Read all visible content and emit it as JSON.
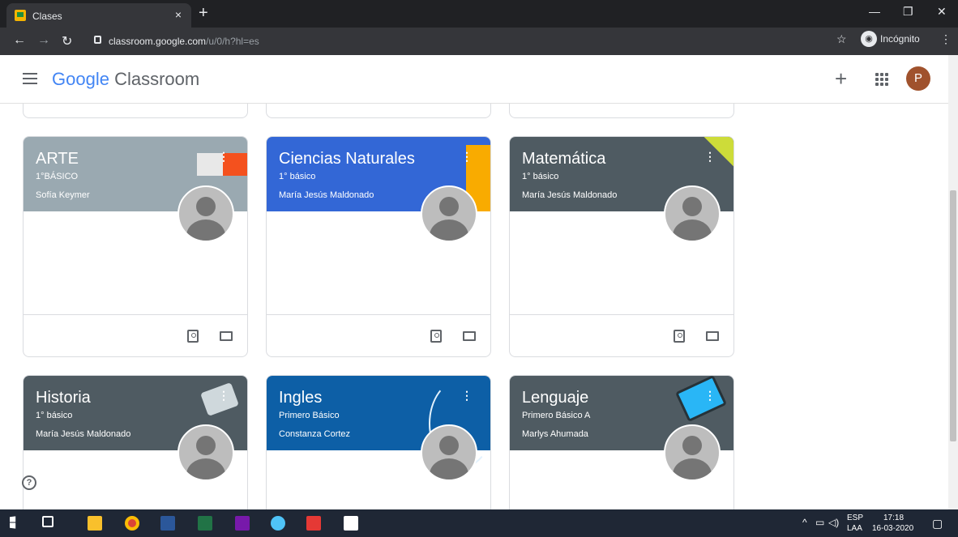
{
  "browser": {
    "tab_title": "Clases",
    "tab_close": "×",
    "new_tab": "+",
    "url_host": "classroom.google.com",
    "url_path": "/u/0/h?hl=es",
    "incognito_label": "Incógnito",
    "window_minimize": "—",
    "window_restore": "❐",
    "window_close": "✕"
  },
  "app": {
    "logo_google": "Google",
    "logo_product": "Classroom",
    "avatar_initial": "P"
  },
  "classes": [
    {
      "name": "ARTE",
      "section": "1°BÁSICO",
      "teacher": "Sofía Keymer",
      "color": "#9aa9b1"
    },
    {
      "name": "Ciencias Naturales",
      "section": "1° básico",
      "teacher": "María Jesús Maldonado",
      "color": "#3367d6"
    },
    {
      "name": "Matemática",
      "section": "1° básico",
      "teacher": "María Jesús Maldonado",
      "color": "#4f5b62"
    },
    {
      "name": "Historia",
      "section": "1° básico",
      "teacher": "María Jesús Maldonado",
      "color": "#4f5b62"
    },
    {
      "name": "Ingles",
      "section": "Primero Básico",
      "teacher": "Constanza Cortez",
      "color": "#0d5fa6"
    },
    {
      "name": "Lenguaje",
      "section": "Primero Básico A",
      "teacher": "Marlys Ahumada",
      "color": "#4f5b62"
    }
  ],
  "taskbar": {
    "lang_top": "ESP",
    "lang_bottom": "LAA",
    "time": "17:18",
    "date": "16-03-2020"
  },
  "icons": [
    "back-icon",
    "forward-icon",
    "reload-icon",
    "lock-icon",
    "star-icon",
    "incognito-icon",
    "hamburger-icon",
    "plus-icon",
    "apps-icon",
    "help-icon",
    "assignment-icon",
    "folder-icon"
  ]
}
